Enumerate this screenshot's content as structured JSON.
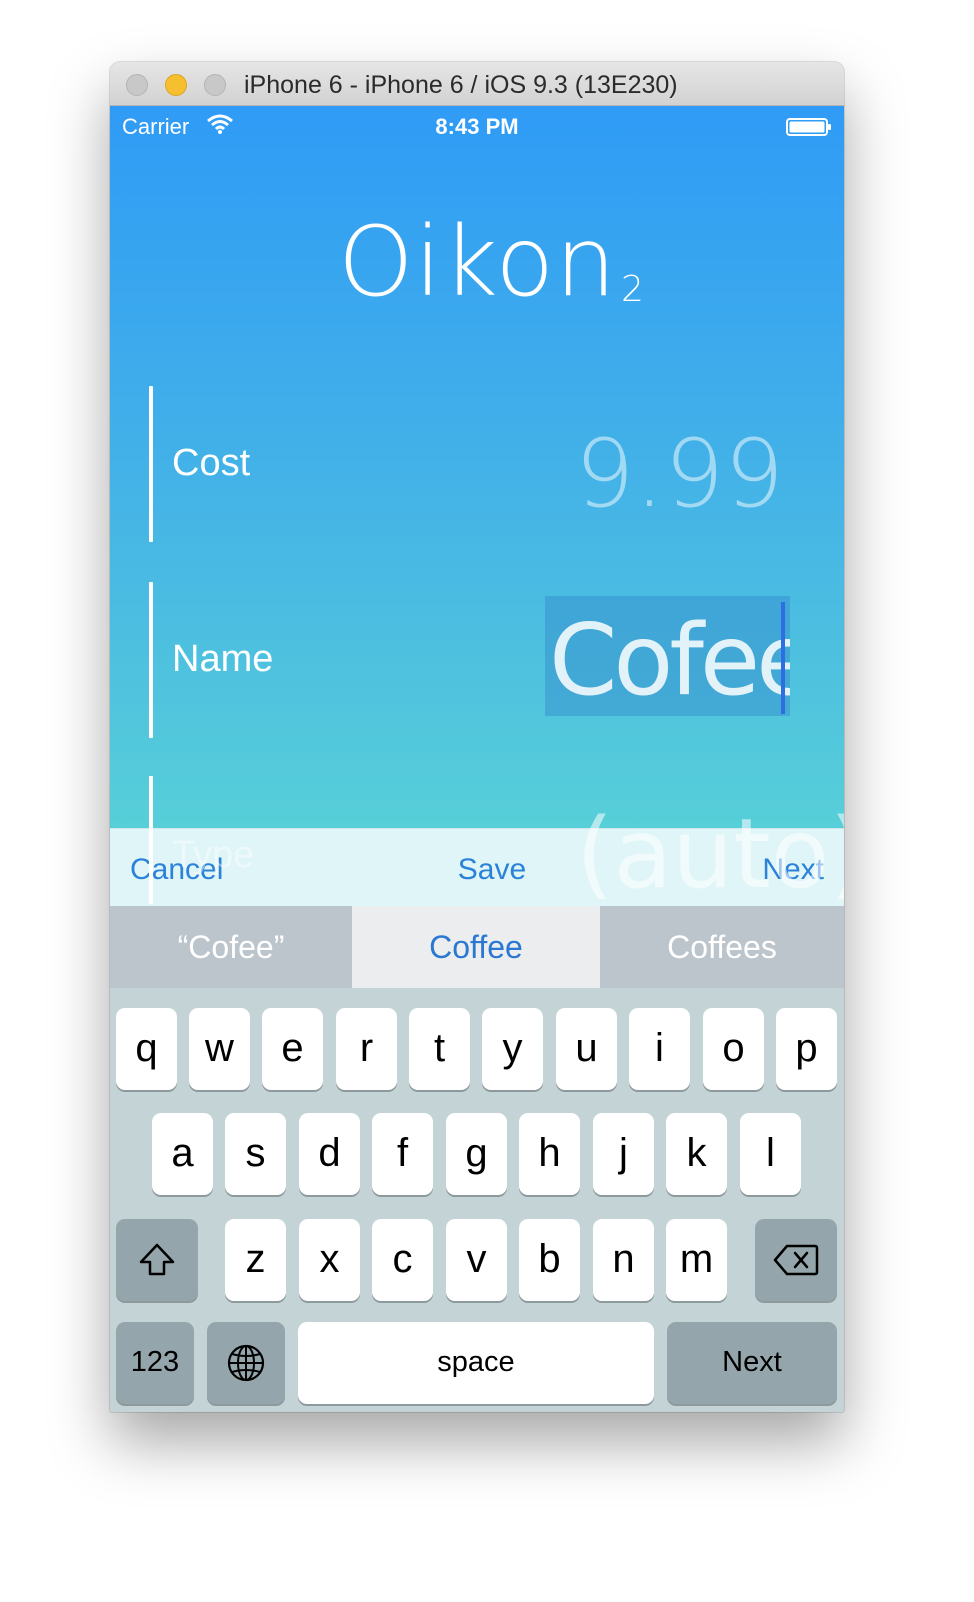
{
  "window": {
    "title": "iPhone 6 - iPhone 6 / iOS 9.3 (13E230)"
  },
  "status_bar": {
    "carrier": "Carrier",
    "time": "8:43 PM",
    "wifi_icon": "wifi-icon",
    "battery_icon": "battery-icon"
  },
  "app": {
    "logo_main": "Oikon",
    "logo_sub": "2",
    "fields": [
      {
        "label": "Cost",
        "value": "9.99"
      },
      {
        "label": "Name",
        "value": "Cofee"
      },
      {
        "label": "Type",
        "value": "(auto)"
      }
    ]
  },
  "toolbar": {
    "cancel": "Cancel",
    "save": "Save",
    "next": "Next",
    "accent": "#2b82d9"
  },
  "suggestions": [
    "“Cofee”",
    "Coffee",
    "Coffees"
  ],
  "keyboard": {
    "row1": [
      "q",
      "w",
      "e",
      "r",
      "t",
      "y",
      "u",
      "i",
      "o",
      "p"
    ],
    "row2": [
      "a",
      "s",
      "d",
      "f",
      "g",
      "h",
      "j",
      "k",
      "l"
    ],
    "row3": [
      "z",
      "x",
      "c",
      "v",
      "b",
      "n",
      "m"
    ],
    "shift_icon": "shift-icon",
    "delete_icon": "delete-icon",
    "numbers": "123",
    "globe_icon": "globe-icon",
    "space": "space",
    "return": "Next"
  },
  "colors": {
    "gradient_top": "#2f9bf6",
    "gradient_bottom": "#57cfd8",
    "keyboard_bg": "#c3d3d6"
  }
}
